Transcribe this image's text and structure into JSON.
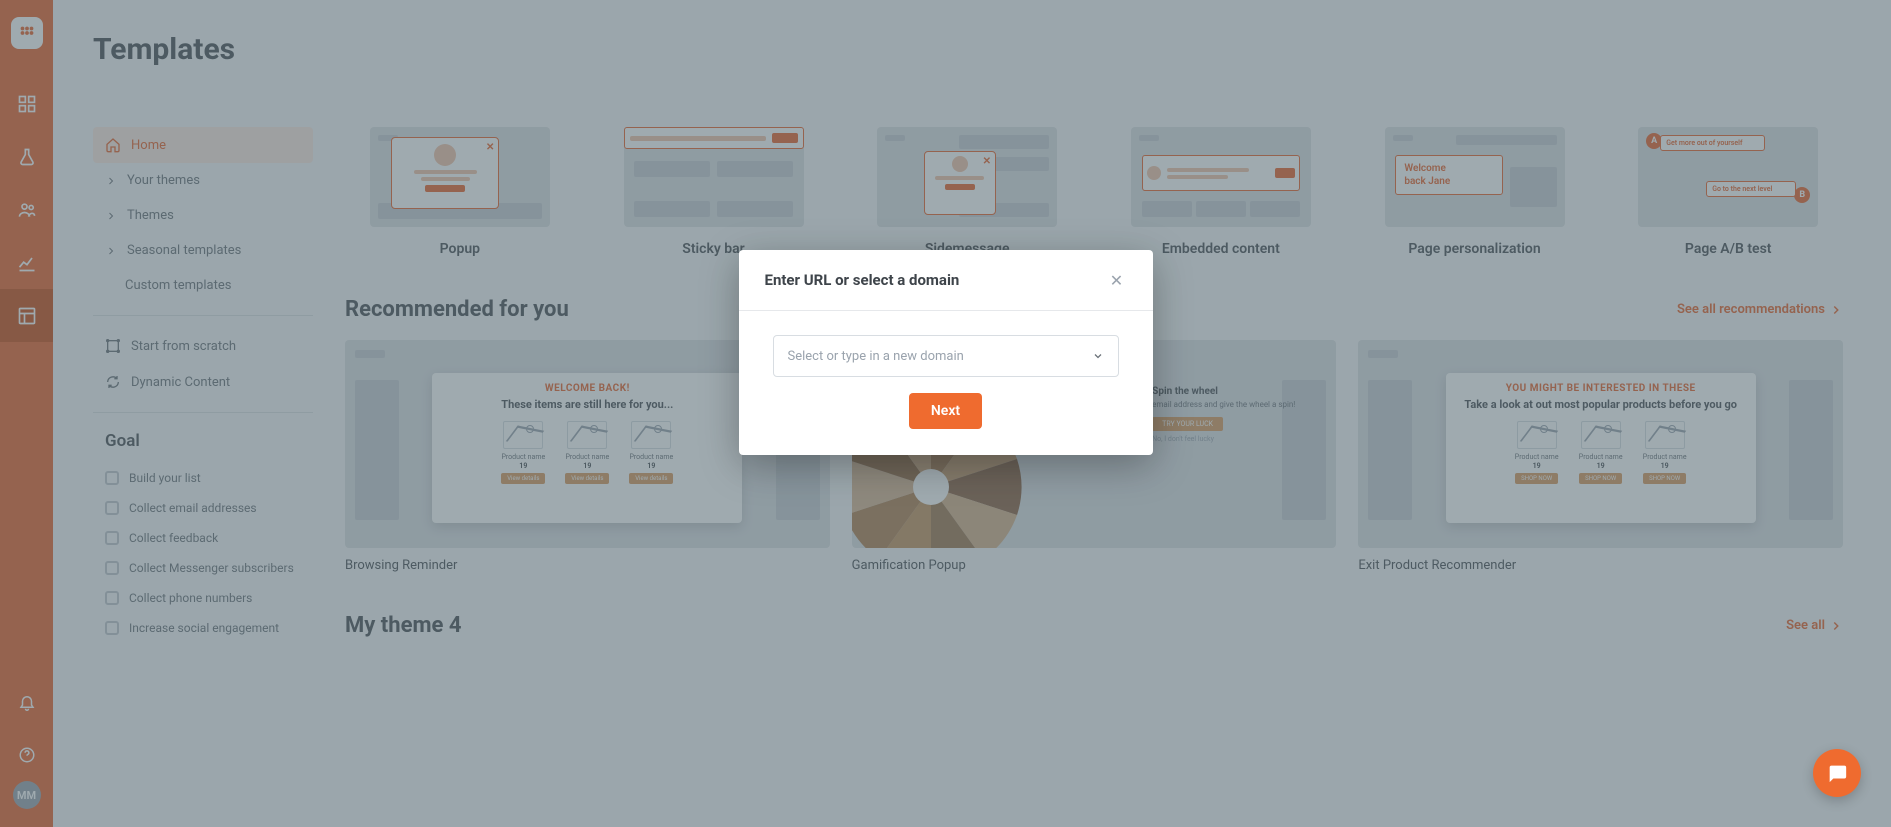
{
  "rail": {
    "avatar_initials": "MM"
  },
  "page": {
    "title": "Templates"
  },
  "sidebar": {
    "home": "Home",
    "your_themes": "Your themes",
    "themes": "Themes",
    "seasonal": "Seasonal templates",
    "custom": "Custom templates",
    "scratch": "Start from scratch",
    "dynamic": "Dynamic Content",
    "goal_title": "Goal",
    "goals": [
      "Build your list",
      "Collect email addresses",
      "Collect feedback",
      "Collect Messenger subscribers",
      "Collect phone numbers",
      "Increase social engagement"
    ]
  },
  "types": [
    {
      "label": "Popup"
    },
    {
      "label": "Sticky bar"
    },
    {
      "label": "Sidemessage"
    },
    {
      "label": "Embedded content"
    },
    {
      "label": "Page personalization"
    },
    {
      "label": "Page A/B test"
    }
  ],
  "personalization": {
    "line1": "Welcome",
    "line2": "back Jane"
  },
  "abTest": {
    "cardA": "Get more out of yourself",
    "cardB": "Go to the next level"
  },
  "recommended": {
    "title": "Recommended for you",
    "see_all": "See all recommendations",
    "items": [
      {
        "label": "Browsing Reminder"
      },
      {
        "label": "Gamification Popup"
      },
      {
        "label": "Exit Product Recommender"
      }
    ],
    "browsing_preview": {
      "eyebrow": "WELCOME BACK!",
      "headline": "These items are still here for you...",
      "product_name": "Product name",
      "price": "19",
      "button": "View details"
    },
    "gamification_preview": {
      "headline": "Spin the wheel",
      "body": "email address and give the wheel a spin!",
      "button": "TRY YOUR LUCK",
      "nothanks": "No, I don't feel lucky"
    },
    "exit_preview": {
      "eyebrow": "YOU MIGHT BE INTERESTED IN THESE",
      "headline": "Take a look at out most popular products before you go",
      "product_name": "Product name",
      "price": "19",
      "button": "SHOP NOW"
    }
  },
  "my_theme": {
    "title": "My theme 4",
    "see_all": "See all"
  },
  "modal": {
    "title": "Enter URL or select a domain",
    "placeholder": "Select or type in a new domain",
    "next": "Next"
  }
}
